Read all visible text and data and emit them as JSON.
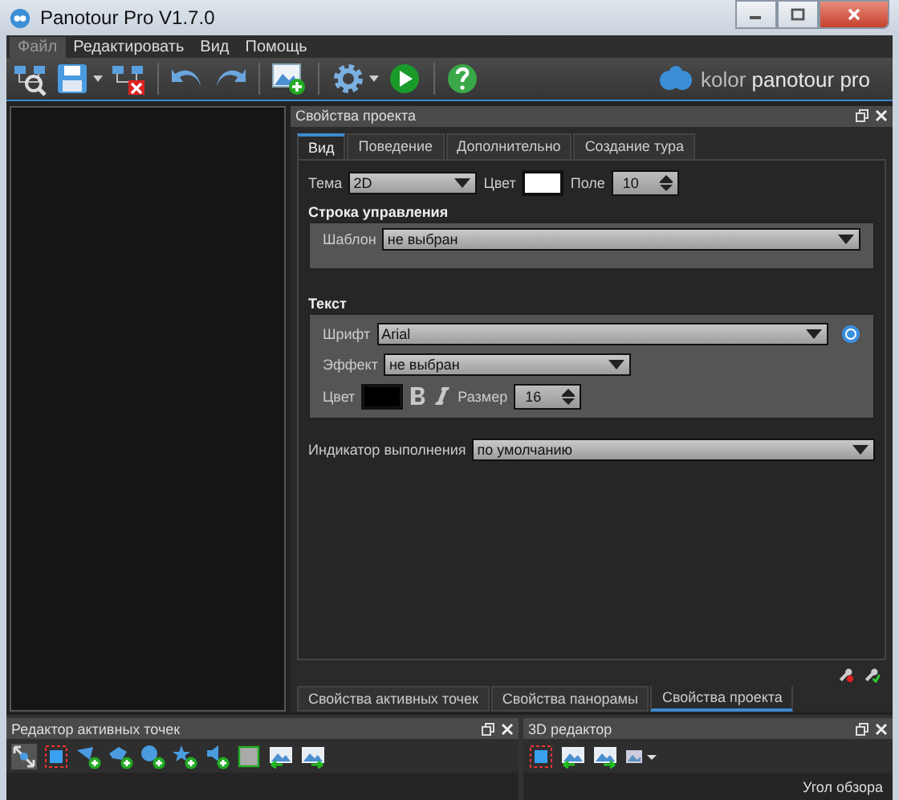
{
  "window": {
    "title": "Panotour Pro V1.7.0"
  },
  "menu": [
    {
      "label": "Файл",
      "selected": true
    },
    {
      "label": "Редактировать",
      "selected": false
    },
    {
      "label": "Вид",
      "selected": false
    },
    {
      "label": "Помощь",
      "selected": false
    }
  ],
  "logo": {
    "brand": "kolor",
    "product": "panotour pro"
  },
  "project_panel": {
    "title": "Свойства проекта",
    "tabs": [
      {
        "label": "Вид",
        "selected": true
      },
      {
        "label": "Поведение",
        "selected": false
      },
      {
        "label": "Дополнительно",
        "selected": false
      },
      {
        "label": "Создание тура",
        "selected": false
      }
    ],
    "theme": {
      "label": "Тема",
      "value": "2D"
    },
    "color": {
      "label": "Цвет",
      "color": "#ffffff"
    },
    "margin": {
      "label": "Поле",
      "value": "10"
    },
    "control_bar": {
      "heading": "Строка управления",
      "template_label": "Шаблон",
      "template_value": "не выбран"
    },
    "text": {
      "heading": "Текст",
      "font_label": "Шрифт",
      "font_value": "Arial",
      "effect_label": "Эффект",
      "effect_value": "не выбран",
      "color": {
        "label": "Цвет",
        "color": "#000000"
      },
      "size_label": "Размер",
      "size_value": "16"
    },
    "progress": {
      "label": "Индикатор выполнения",
      "value": "по умолчанию"
    }
  },
  "bottom_tabs": [
    {
      "label": "Свойства активных точек",
      "selected": false
    },
    {
      "label": "Свойства панорамы",
      "selected": false
    },
    {
      "label": "Свойства проекта",
      "selected": true
    }
  ],
  "hotspot_editor": {
    "title": "Редактор активных точек"
  },
  "editor_3d": {
    "title": "3D редактор",
    "fov_label": "Угол обзора"
  }
}
